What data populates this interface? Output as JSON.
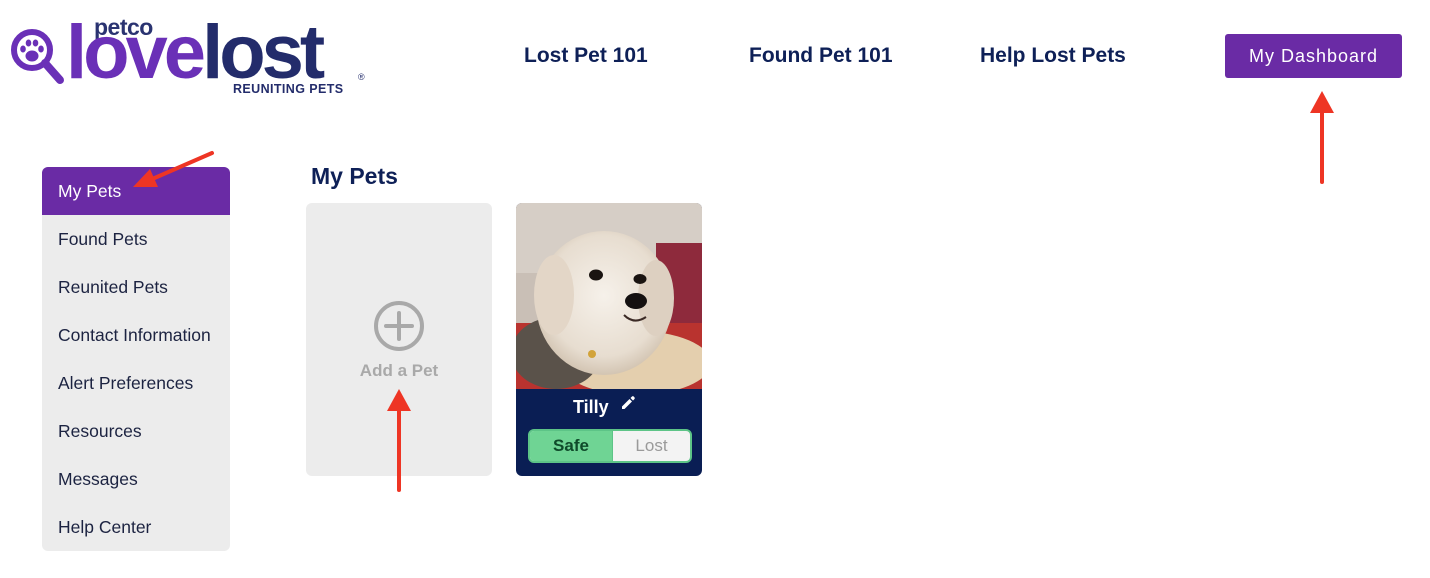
{
  "logo": {
    "petco": "petco",
    "love": "love",
    "lost": "lost",
    "reg": "®",
    "tagline": "REUNITING PETS"
  },
  "nav": {
    "links": [
      "Lost Pet 101",
      "Found Pet 101",
      "Help Lost Pets"
    ],
    "dashboard_button": "My Dashboard"
  },
  "sidebar": {
    "items": [
      {
        "label": "My Pets",
        "active": true
      },
      {
        "label": "Found Pets"
      },
      {
        "label": "Reunited Pets"
      },
      {
        "label": "Contact Information"
      },
      {
        "label": "Alert Preferences"
      },
      {
        "label": "Resources"
      },
      {
        "label": "Messages"
      },
      {
        "label": "Help Center"
      }
    ]
  },
  "main": {
    "title": "My Pets",
    "add_card": {
      "label": "Add a Pet",
      "icon": "plus-circle-icon"
    },
    "pets": [
      {
        "name": "Tilly",
        "status_options": [
          "Safe",
          "Lost"
        ],
        "status": "Safe"
      }
    ]
  },
  "colors": {
    "brand_purple": "#6a2ba5",
    "brand_navy": "#0a1e54",
    "safe_green": "#6fd494",
    "annotation_red": "#ee3524"
  }
}
